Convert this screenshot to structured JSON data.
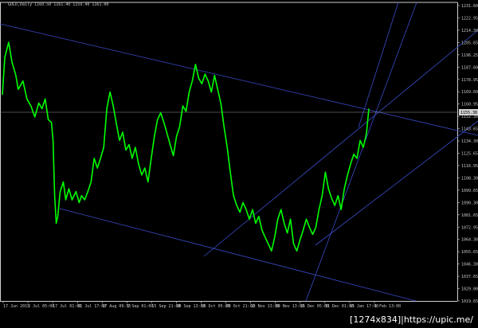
{
  "header": {
    "symbol_info": "GOLD,Daily 1160.50 1161.40 1159.40 1161.00"
  },
  "chart_data": {
    "type": "line",
    "ylim": [
      1020.0,
      1232.0
    ],
    "grid": false,
    "background": "#000000",
    "series_color": "#00ff00",
    "trendline_color": "#3a4cc8",
    "current_price_label": "1155.38",
    "y_ticks": [
      "1231.60",
      "1222.95",
      "1214.30",
      "1205.65",
      "1196.25",
      "1187.60",
      "1178.95",
      "1169.60",
      "1160.95",
      "1152.30",
      "1143.65",
      "1134.30",
      "1125.65",
      "1116.95",
      "1108.30",
      "1099.65",
      "1090.30",
      "1081.65",
      "1072.95",
      "1064.30",
      "1055.65",
      "1046.30",
      "1037.65",
      "1029.00",
      "1019.65"
    ],
    "x_ticks": [
      "17 Jun 2015",
      "2 Jul 05:00",
      "17 Jul 01:00",
      "31 Jul 17:00",
      "17 Aug 09:55",
      "1 Sep 01:00",
      "15 Sep 21:00",
      "30 Sep 13:00",
      "15 Oct 05:00",
      "29 Oct 21:00",
      "12 Nov 13:00",
      "30 Nov 13:00",
      "15 Dec 05:00",
      "31 Dec 01:00",
      "15 Jan 17:00",
      "1 Feb 13:00"
    ],
    "price_path": [
      [
        0,
        1168
      ],
      [
        3,
        1195
      ],
      [
        8,
        1206
      ],
      [
        12,
        1192
      ],
      [
        17,
        1182
      ],
      [
        20,
        1172
      ],
      [
        26,
        1178
      ],
      [
        31,
        1165
      ],
      [
        36,
        1160
      ],
      [
        41,
        1152
      ],
      [
        46,
        1162
      ],
      [
        50,
        1158
      ],
      [
        54,
        1165
      ],
      [
        58,
        1150
      ],
      [
        62,
        1148
      ],
      [
        64,
        1135
      ],
      [
        66,
        1095
      ],
      [
        68,
        1075
      ],
      [
        70,
        1080
      ],
      [
        73,
        1098
      ],
      [
        77,
        1105
      ],
      [
        80,
        1092
      ],
      [
        84,
        1100
      ],
      [
        88,
        1092
      ],
      [
        93,
        1098
      ],
      [
        97,
        1090
      ],
      [
        100,
        1095
      ],
      [
        104,
        1092
      ],
      [
        108,
        1098
      ],
      [
        112,
        1105
      ],
      [
        116,
        1122
      ],
      [
        120,
        1115
      ],
      [
        124,
        1122
      ],
      [
        128,
        1130
      ],
      [
        132,
        1158
      ],
      [
        136,
        1170
      ],
      [
        140,
        1160
      ],
      [
        144,
        1147
      ],
      [
        148,
        1135
      ],
      [
        152,
        1141
      ],
      [
        156,
        1128
      ],
      [
        160,
        1132
      ],
      [
        164,
        1122
      ],
      [
        168,
        1130
      ],
      [
        172,
        1118
      ],
      [
        176,
        1110
      ],
      [
        180,
        1115
      ],
      [
        184,
        1105
      ],
      [
        188,
        1122
      ],
      [
        192,
        1138
      ],
      [
        196,
        1150
      ],
      [
        200,
        1155
      ],
      [
        204,
        1148
      ],
      [
        208,
        1140
      ],
      [
        212,
        1132
      ],
      [
        216,
        1124
      ],
      [
        220,
        1138
      ],
      [
        224,
        1145
      ],
      [
        228,
        1160
      ],
      [
        232,
        1156
      ],
      [
        236,
        1170
      ],
      [
        240,
        1178
      ],
      [
        244,
        1190
      ],
      [
        248,
        1180
      ],
      [
        252,
        1176
      ],
      [
        256,
        1183
      ],
      [
        260,
        1178
      ],
      [
        264,
        1170
      ],
      [
        268,
        1182
      ],
      [
        272,
        1172
      ],
      [
        276,
        1162
      ],
      [
        280,
        1145
      ],
      [
        284,
        1130
      ],
      [
        288,
        1112
      ],
      [
        292,
        1095
      ],
      [
        296,
        1088
      ],
      [
        300,
        1083
      ],
      [
        304,
        1090
      ],
      [
        308,
        1085
      ],
      [
        312,
        1078
      ],
      [
        316,
        1085
      ],
      [
        320,
        1075
      ],
      [
        324,
        1080
      ],
      [
        328,
        1070
      ],
      [
        332,
        1065
      ],
      [
        336,
        1060
      ],
      [
        340,
        1055
      ],
      [
        344,
        1065
      ],
      [
        348,
        1078
      ],
      [
        352,
        1085
      ],
      [
        356,
        1075
      ],
      [
        360,
        1068
      ],
      [
        364,
        1078
      ],
      [
        368,
        1060
      ],
      [
        372,
        1055
      ],
      [
        376,
        1063
      ],
      [
        380,
        1070
      ],
      [
        384,
        1078
      ],
      [
        388,
        1072
      ],
      [
        392,
        1067
      ],
      [
        396,
        1072
      ],
      [
        400,
        1085
      ],
      [
        404,
        1095
      ],
      [
        408,
        1112
      ],
      [
        412,
        1100
      ],
      [
        416,
        1093
      ],
      [
        420,
        1088
      ],
      [
        424,
        1095
      ],
      [
        428,
        1085
      ],
      [
        432,
        1100
      ],
      [
        436,
        1110
      ],
      [
        440,
        1118
      ],
      [
        444,
        1125
      ],
      [
        448,
        1122
      ],
      [
        452,
        1135
      ],
      [
        456,
        1130
      ],
      [
        460,
        1140
      ],
      [
        463,
        1158
      ]
    ]
  }
}
